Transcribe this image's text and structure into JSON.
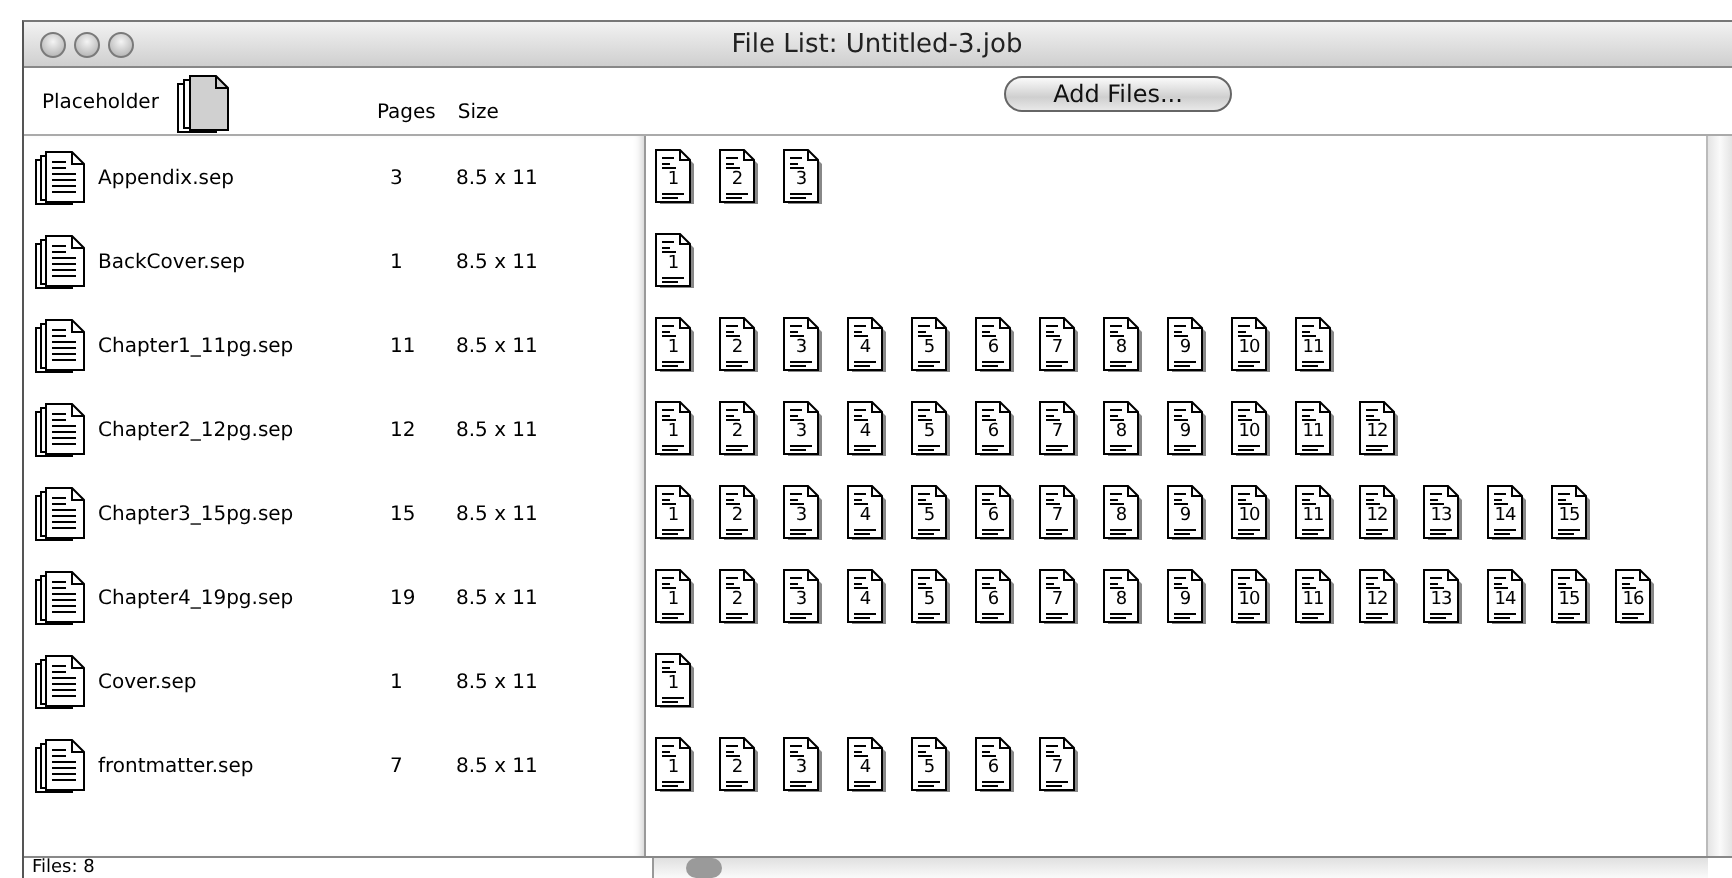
{
  "window": {
    "title": "File List: Untitled-3.job"
  },
  "header": {
    "placeholder_label": "Placeholder",
    "columns": [
      "Pages",
      "Size"
    ],
    "add_button": "Add Files..."
  },
  "files": [
    {
      "name": "Appendix.sep",
      "pages": "3",
      "size": "8.5 x 11",
      "page_labels": [
        "1",
        "2",
        "3"
      ]
    },
    {
      "name": "BackCover.sep",
      "pages": "1",
      "size": "8.5 x 11",
      "page_labels": [
        "1"
      ]
    },
    {
      "name": "Chapter1_11pg.sep",
      "pages": "11",
      "size": "8.5 x 11",
      "page_labels": [
        "1",
        "2",
        "3",
        "4",
        "5",
        "6",
        "7",
        "8",
        "9",
        "10",
        "11"
      ]
    },
    {
      "name": "Chapter2_12pg.sep",
      "pages": "12",
      "size": "8.5 x 11",
      "page_labels": [
        "1",
        "2",
        "3",
        "4",
        "5",
        "6",
        "7",
        "8",
        "9",
        "10",
        "11",
        "12"
      ]
    },
    {
      "name": "Chapter3_15pg.sep",
      "pages": "15",
      "size": "8.5 x 11",
      "page_labels": [
        "1",
        "2",
        "3",
        "4",
        "5",
        "6",
        "7",
        "8",
        "9",
        "10",
        "11",
        "12",
        "13",
        "14",
        "15"
      ]
    },
    {
      "name": "Chapter4_19pg.sep",
      "pages": "19",
      "size": "8.5 x 11",
      "page_labels": [
        "1",
        "2",
        "3",
        "4",
        "5",
        "6",
        "7",
        "8",
        "9",
        "10",
        "11",
        "12",
        "13",
        "14",
        "15",
        "16"
      ]
    },
    {
      "name": "Cover.sep",
      "pages": "1",
      "size": "8.5 x 11",
      "page_labels": [
        "1"
      ]
    },
    {
      "name": "frontmatter.sep",
      "pages": "7",
      "size": "8.5 x 11",
      "page_labels": [
        "1",
        "2",
        "3",
        "4",
        "5",
        "6",
        "7"
      ]
    }
  ],
  "status_bar": "Files: 8"
}
